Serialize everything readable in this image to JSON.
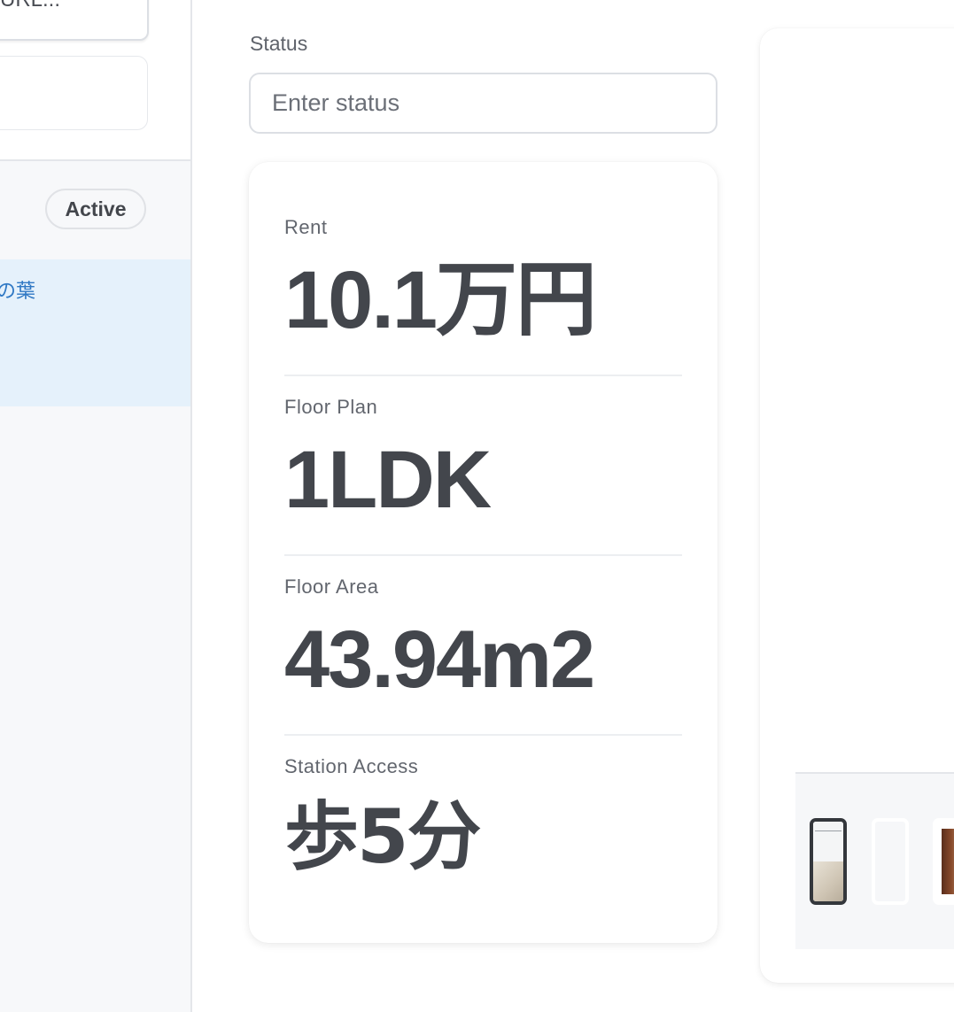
{
  "sidebar": {
    "url_text": "URL...",
    "status_badge": "Active",
    "selected_item_title": "の葉"
  },
  "status": {
    "label": "Status",
    "placeholder": "Enter status",
    "value": ""
  },
  "stats": [
    {
      "label": "Rent",
      "value": "10.1万円"
    },
    {
      "label": "Floor Plan",
      "value": "1LDK"
    },
    {
      "label": "Floor Area",
      "value": "43.94m2"
    },
    {
      "label": "Station Access",
      "value": "歩5分"
    }
  ],
  "gallery": {
    "selected_index": 0,
    "thumbnail_count": 3
  }
}
